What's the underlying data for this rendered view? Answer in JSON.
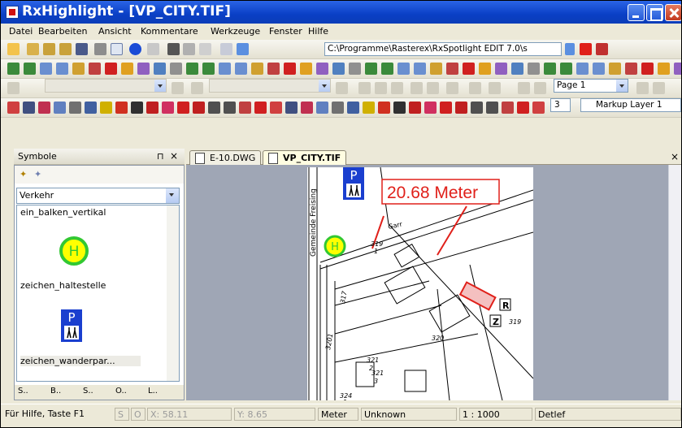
{
  "window": {
    "title": "RxHighlight - [VP_CITY.TIF]"
  },
  "menu": [
    "Datei",
    "Bearbeiten",
    "Ansicht",
    "Kommentare",
    "Werkzeuge",
    "Fenster",
    "Hilfe"
  ],
  "toolbar": {
    "path_value": "C:\\Programme\\Rasterex\\RxSpotlight EDIT 7.0\\s",
    "page_value": "Page 1",
    "line_width_value": "3",
    "markup_layer_value": "Markup Layer 1"
  },
  "symbol_panel": {
    "title": "Symbole",
    "category": "Verkehr",
    "items": [
      {
        "label": "ein_balken_vertikal",
        "icon": "none"
      },
      {
        "label": "zeichen_haltestelle",
        "icon": "bus-stop-icon"
      },
      {
        "label": "zeichen_wanderpar...",
        "icon": "hiking-parking-icon"
      }
    ],
    "bottom_tabs": [
      "S..",
      "B..",
      "S..",
      "O..",
      "L.."
    ]
  },
  "doc_tabs": [
    {
      "label": "E-10.DWG",
      "active": false
    },
    {
      "label": "VP_CITY.TIF",
      "active": true
    }
  ],
  "drawing": {
    "measure_label": "20.68 Meter",
    "street_label": "Gemeinde Freising",
    "garage_label": "Garr",
    "parcel_labels": [
      "319",
      "1",
      "320",
      "321",
      "2",
      "321",
      "3",
      "319",
      "3201",
      "324",
      "1",
      "317"
    ],
    "marker_r": "R",
    "marker_z": "Z",
    "p_sign": "P",
    "bus_sign": "H"
  },
  "status": {
    "help": "Für Hilfe, Taste F1",
    "s": "S",
    "o": "O",
    "x": "X: 58.11",
    "y": "Y: 8.65",
    "unit": "Meter",
    "unknown": "Unknown",
    "scale": "1 : 1000",
    "user": "Detlef"
  },
  "colors": {
    "title_bar": "#0a3fc5",
    "markup_red": "#e0201a",
    "sign_blue": "#1a3fcf",
    "bus_green": "#32c832",
    "bus_yellow": "#ffff00"
  }
}
